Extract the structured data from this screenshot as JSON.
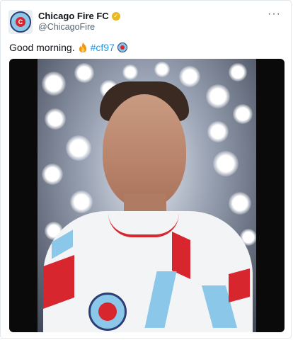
{
  "account": {
    "display_name": "Chicago Fire FC",
    "handle": "@ChicagoFire",
    "verified_icon": "gold-checkmark-icon",
    "avatar_icon": "chicago-fire-crest-icon"
  },
  "menu": {
    "more_label": "···"
  },
  "tweet": {
    "text": "Good morning.",
    "emoji_icon": "fire-emoji-icon",
    "hashtag": "#cf97",
    "hashtag_icon": "chicago-fire-crest-icon"
  },
  "media": {
    "type": "video",
    "icon": "video-player"
  },
  "colors": {
    "text": "#0f1419",
    "secondary": "#536471",
    "link": "#1d9bf0",
    "brand_red": "#d8262f",
    "brand_blue": "#8bc7e8",
    "brand_navy": "#2c3e73",
    "verified_gold": "#e8b923"
  }
}
